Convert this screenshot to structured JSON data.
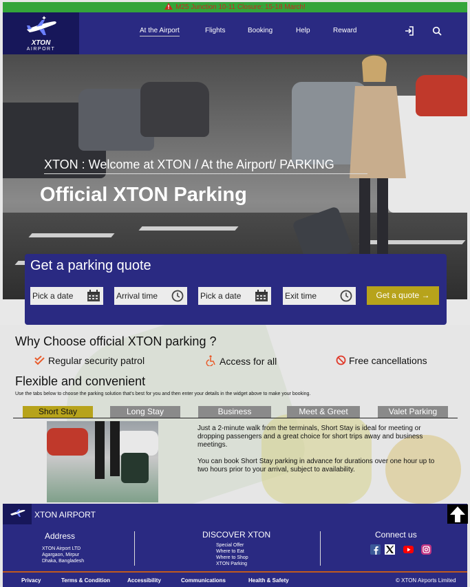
{
  "alert": {
    "text": "M25 Junction 10-11 Closure: 15-18 March!"
  },
  "logo": {
    "name": "XTON",
    "subtitle": "AIRPORT"
  },
  "nav": {
    "items": [
      "At the Airport",
      "Flights",
      "Booking",
      "Help",
      "Reward"
    ]
  },
  "hero": {
    "breadcrumb": "XTON : Welcome at XTON / At the Airport/ PARKING",
    "title": "Official XTON Parking"
  },
  "quote": {
    "title": "Get a parking quote",
    "fields": [
      "Pick a date",
      "Arrival time",
      "Pick a date",
      "Exit time"
    ],
    "button": "Get a quote →"
  },
  "why": {
    "title": "Why Choose official XTON parking ?",
    "features": [
      "Regular security patrol",
      "Access for all",
      "Free cancellations"
    ]
  },
  "flexible": {
    "title": "Flexible and convenient",
    "text": "Use the tabs below to choose the parking solution that's best for you and then enter your details in the widget above to make your booking."
  },
  "tabs": [
    "Short Stay",
    "Long Stay",
    "Business",
    "Meet & Greet",
    "Valet Parking"
  ],
  "short_stay": {
    "p1": "Just a 2-minute walk from the terminals, Short Stay is ideal for meeting or dropping passengers and a great choice for short trips away and business meetings.",
    "p2": "You can book Short Stay parking in advance for durations over one hour up to two hours prior to your arrival, subject to availability."
  },
  "footer": {
    "brand": "XTON AIRPORT",
    "address_title": "Address",
    "address_lines": [
      "XTON Airport LTD",
      "Agargaon, Mirpur",
      "Dhaka, Bangladesh"
    ],
    "discover_title": "DISCOVER XTON",
    "discover_links": [
      "Special Offer",
      "Where to Eat",
      "Where to Shop",
      "XTON Parking"
    ],
    "connect_title": "Connect us",
    "social": [
      "facebook-icon",
      "x-icon",
      "youtube-icon",
      "instagram-icon"
    ]
  },
  "bottom": {
    "links": [
      "Privacy",
      "Terms & Condition",
      "Accessibility",
      "Communications",
      "Health & Safety"
    ],
    "copyright": "© XTON Airports Limited"
  },
  "colors": {
    "navy": "#2a2a82",
    "dark_navy": "#17175a",
    "gold": "#b7a31b",
    "alert_green": "#34a53a",
    "alert_red": "#c8291f"
  }
}
